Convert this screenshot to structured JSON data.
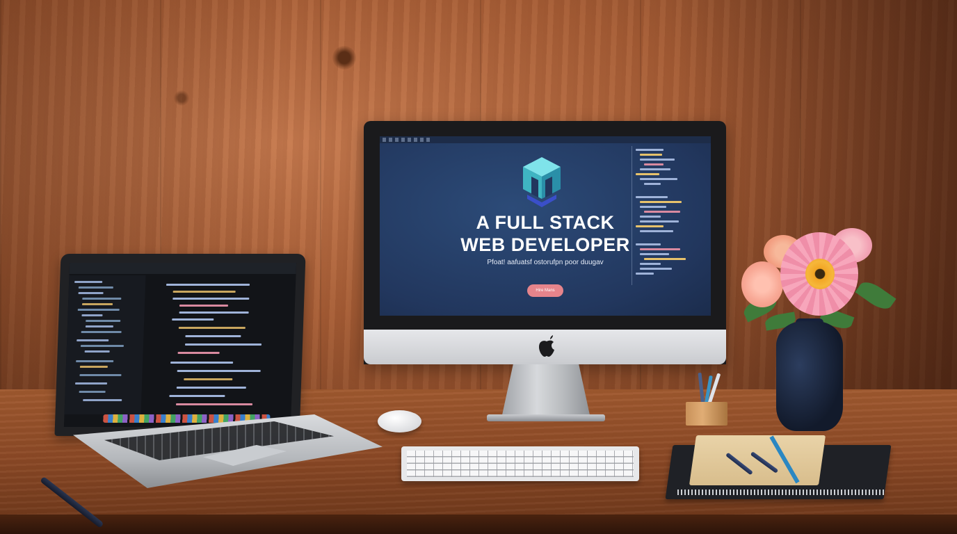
{
  "scene": {
    "description_label": "Developer desk workspace"
  },
  "imac_screen": {
    "hero_title_line1": "A FULL STACK",
    "hero_title_line2": "WEB DEVELOPER",
    "hero_subtitle": "Pfoat! aafuatsf ostorufpn poor duugav",
    "hero_button": "Hire Mans"
  },
  "colors": {
    "wood_wall": "#a65d36",
    "desk": "#8d4a26",
    "screen_bg": "#22375e",
    "button": "#e6848b",
    "logo_teal": "#5fd0d8",
    "flower_pink": "#f4a0b8",
    "flower_center": "#f2a524"
  },
  "icons": {
    "imac_logo": "apple-logo-icon",
    "hero_logo": "cube-logo-icon"
  }
}
